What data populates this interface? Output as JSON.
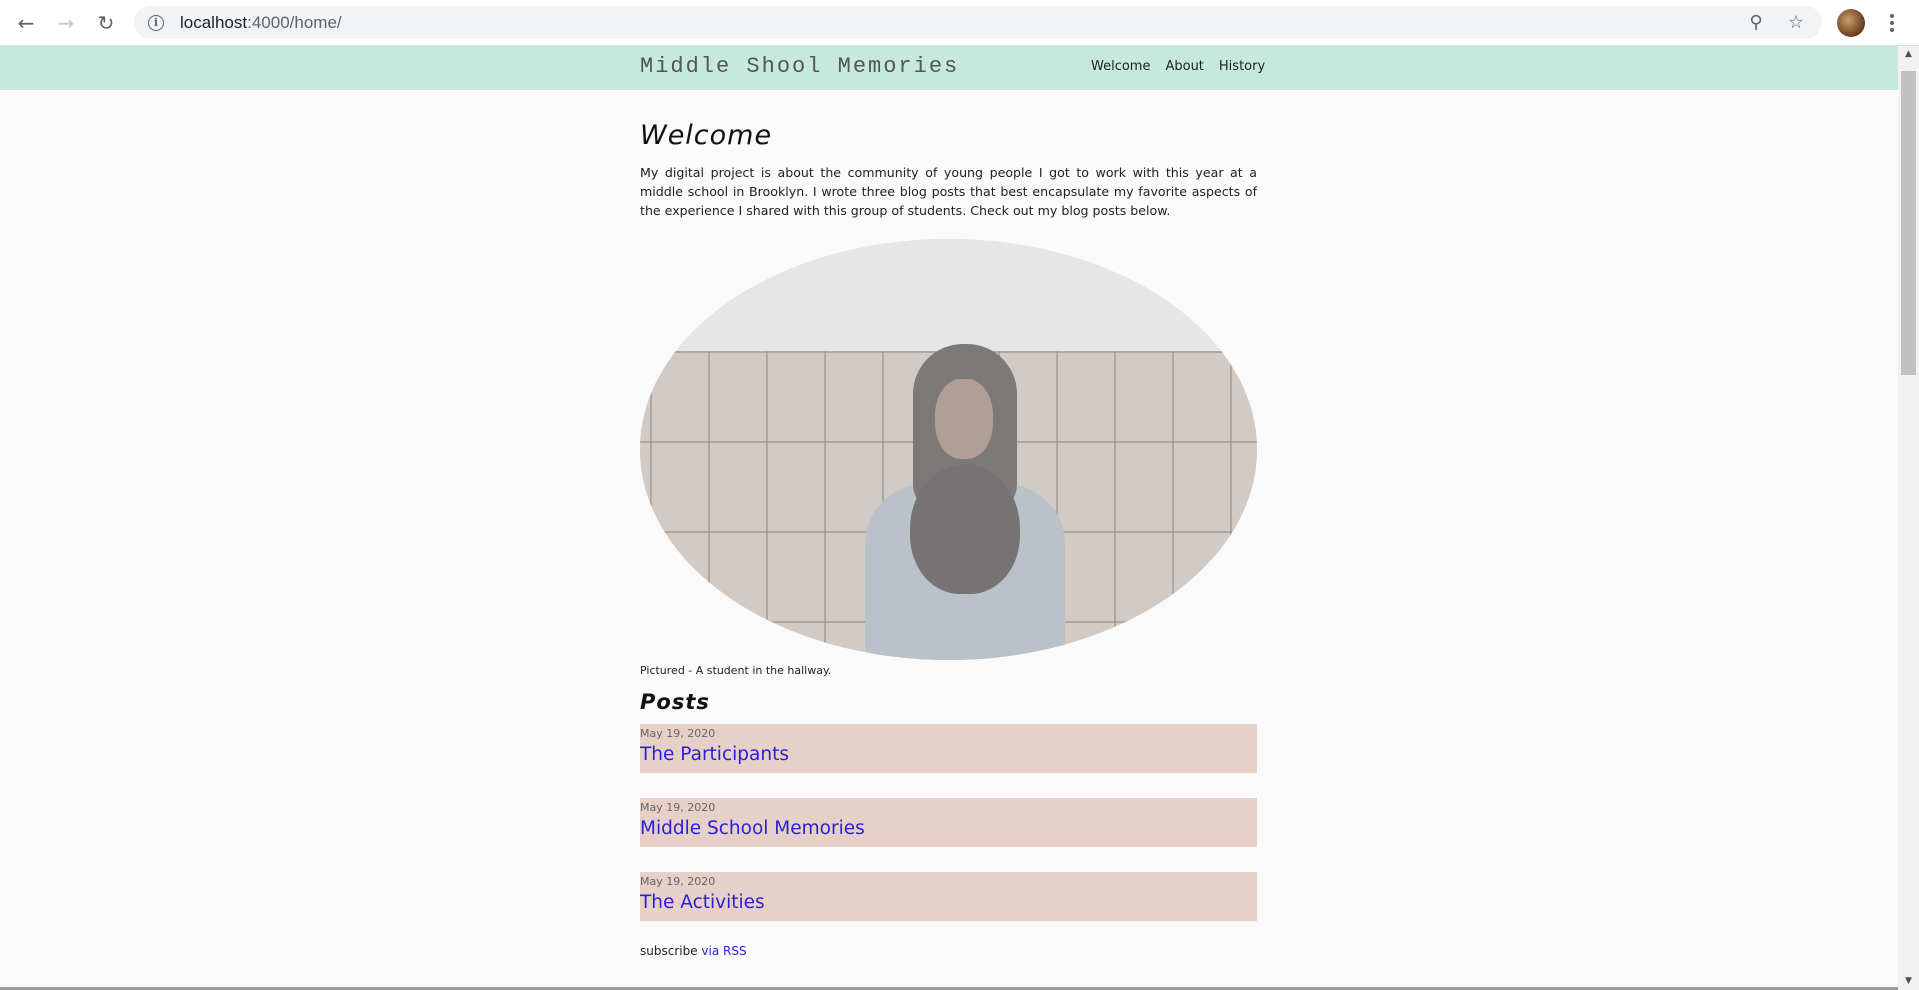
{
  "browser": {
    "url_host": "localhost",
    "url_path": ":4000/home/",
    "icons": {
      "back": "back-arrow-icon",
      "forward": "forward-arrow-icon",
      "reload": "reload-icon",
      "info": "info-icon",
      "zoom": "zoom-icon",
      "bookmark": "star-icon",
      "menu": "menu-dots-icon"
    }
  },
  "site": {
    "title": "Middle Shool Memories",
    "nav": [
      "Welcome",
      "About",
      "History"
    ],
    "header_color": "#c6e9dd"
  },
  "main": {
    "heading": "Welcome",
    "intro": "My digital project is about the community of young people I got to work with this year at a middle school in Brooklyn. I wrote three blog posts that best encapsulate my favorite aspects of the experience I shared with this group of students. Check out my blog posts below.",
    "caption": "Pictured - A student in the hallway.",
    "posts_heading": "Posts",
    "posts": [
      {
        "date": "May 19, 2020",
        "title": "The Participants"
      },
      {
        "date": "May 19, 2020",
        "title": "Middle School Memories"
      },
      {
        "date": "May 19, 2020",
        "title": "The Activities"
      }
    ],
    "subscribe_text": "subscribe ",
    "subscribe_link": "via RSS",
    "post_bg_color": "#e6d0c8",
    "link_color": "#2b1fd6"
  }
}
